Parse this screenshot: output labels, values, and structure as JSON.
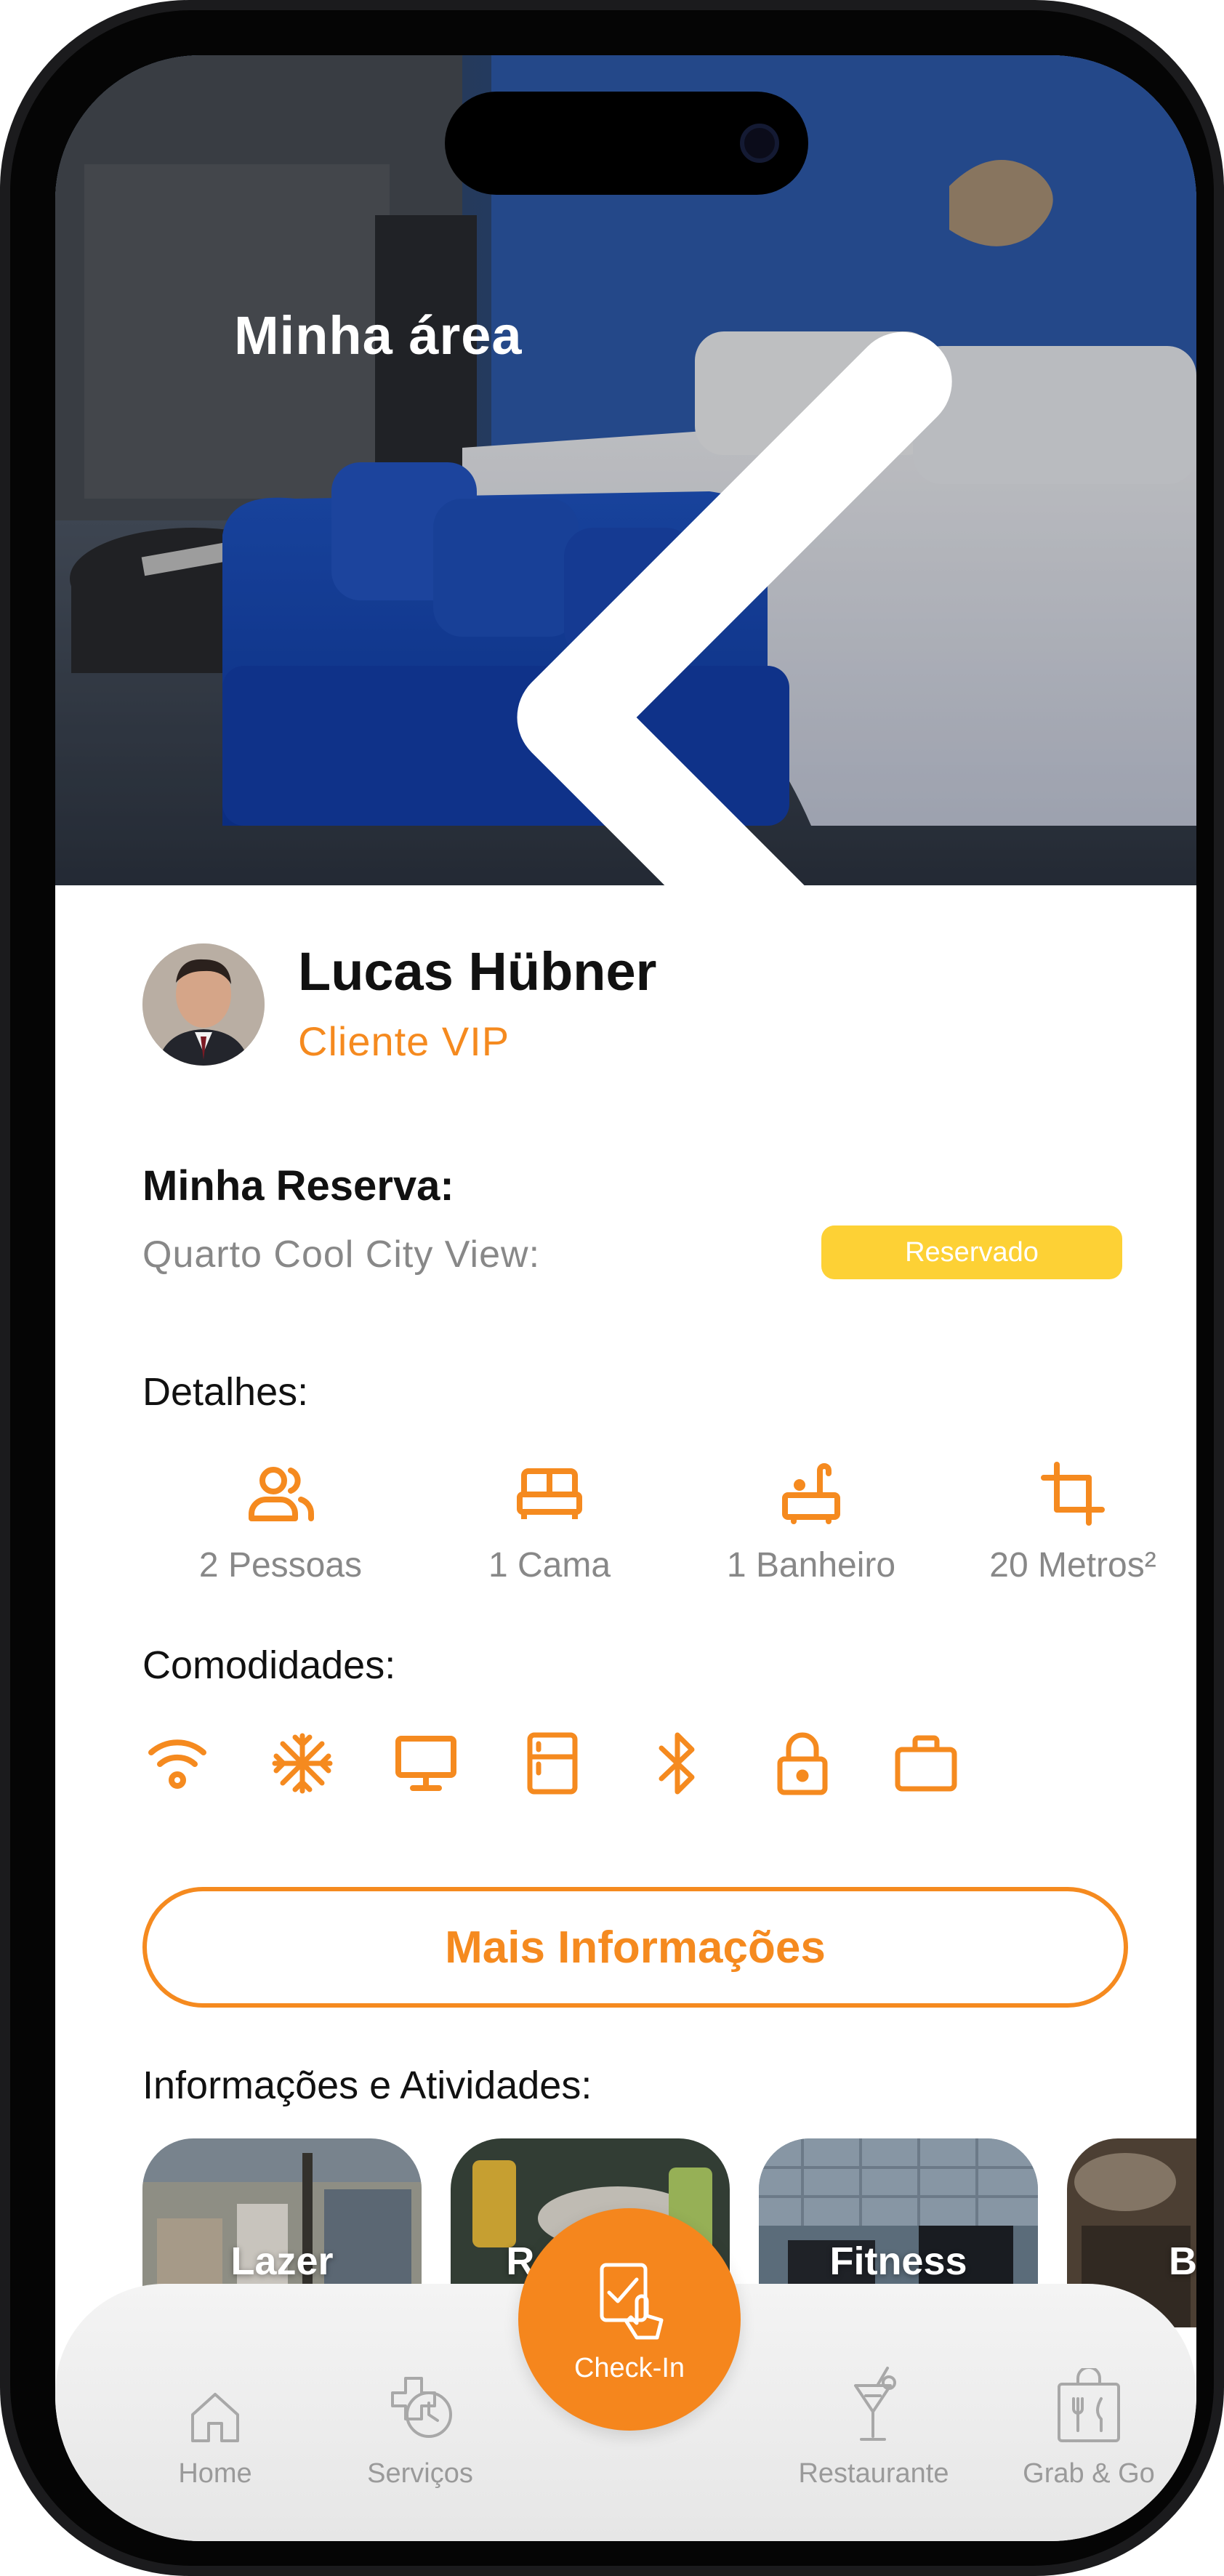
{
  "header": {
    "title": "Minha área"
  },
  "profile": {
    "name": "Lucas Hübner",
    "status": "Cliente VIP"
  },
  "reservation": {
    "heading": "Minha Reserva:",
    "room": "Quarto Cool City View:",
    "status_badge": "Reservado"
  },
  "details": {
    "heading": "Detalhes:",
    "items": [
      {
        "icon": "people-icon",
        "label": "2 Pessoas"
      },
      {
        "icon": "bed-icon",
        "label": "1 Cama"
      },
      {
        "icon": "bathtub-icon",
        "label": "1 Banheiro"
      },
      {
        "icon": "crop-area-icon",
        "label": "20 Metros²"
      }
    ]
  },
  "amenities": {
    "heading": "Comodidades:",
    "icons": [
      "wifi-icon",
      "air-conditioning-icon",
      "tv-icon",
      "minibar-icon",
      "bluetooth-icon",
      "safe-lock-icon",
      "luggage-icon"
    ]
  },
  "more_button": "Mais Informações",
  "activities": {
    "heading": "Informações e Atividades:",
    "cards": [
      {
        "label": "Lazer"
      },
      {
        "label": "Reservar"
      },
      {
        "label": "Fitness"
      },
      {
        "label": "B"
      }
    ]
  },
  "nav": {
    "home": "Home",
    "services": "Serviços",
    "checkin": "Check-In",
    "restaurant": "Restaurante",
    "grab": "Grab & Go"
  },
  "colors": {
    "accent": "#f58a1f",
    "badge": "#fdd135",
    "text_dark": "#111111",
    "text_muted": "#888888"
  }
}
